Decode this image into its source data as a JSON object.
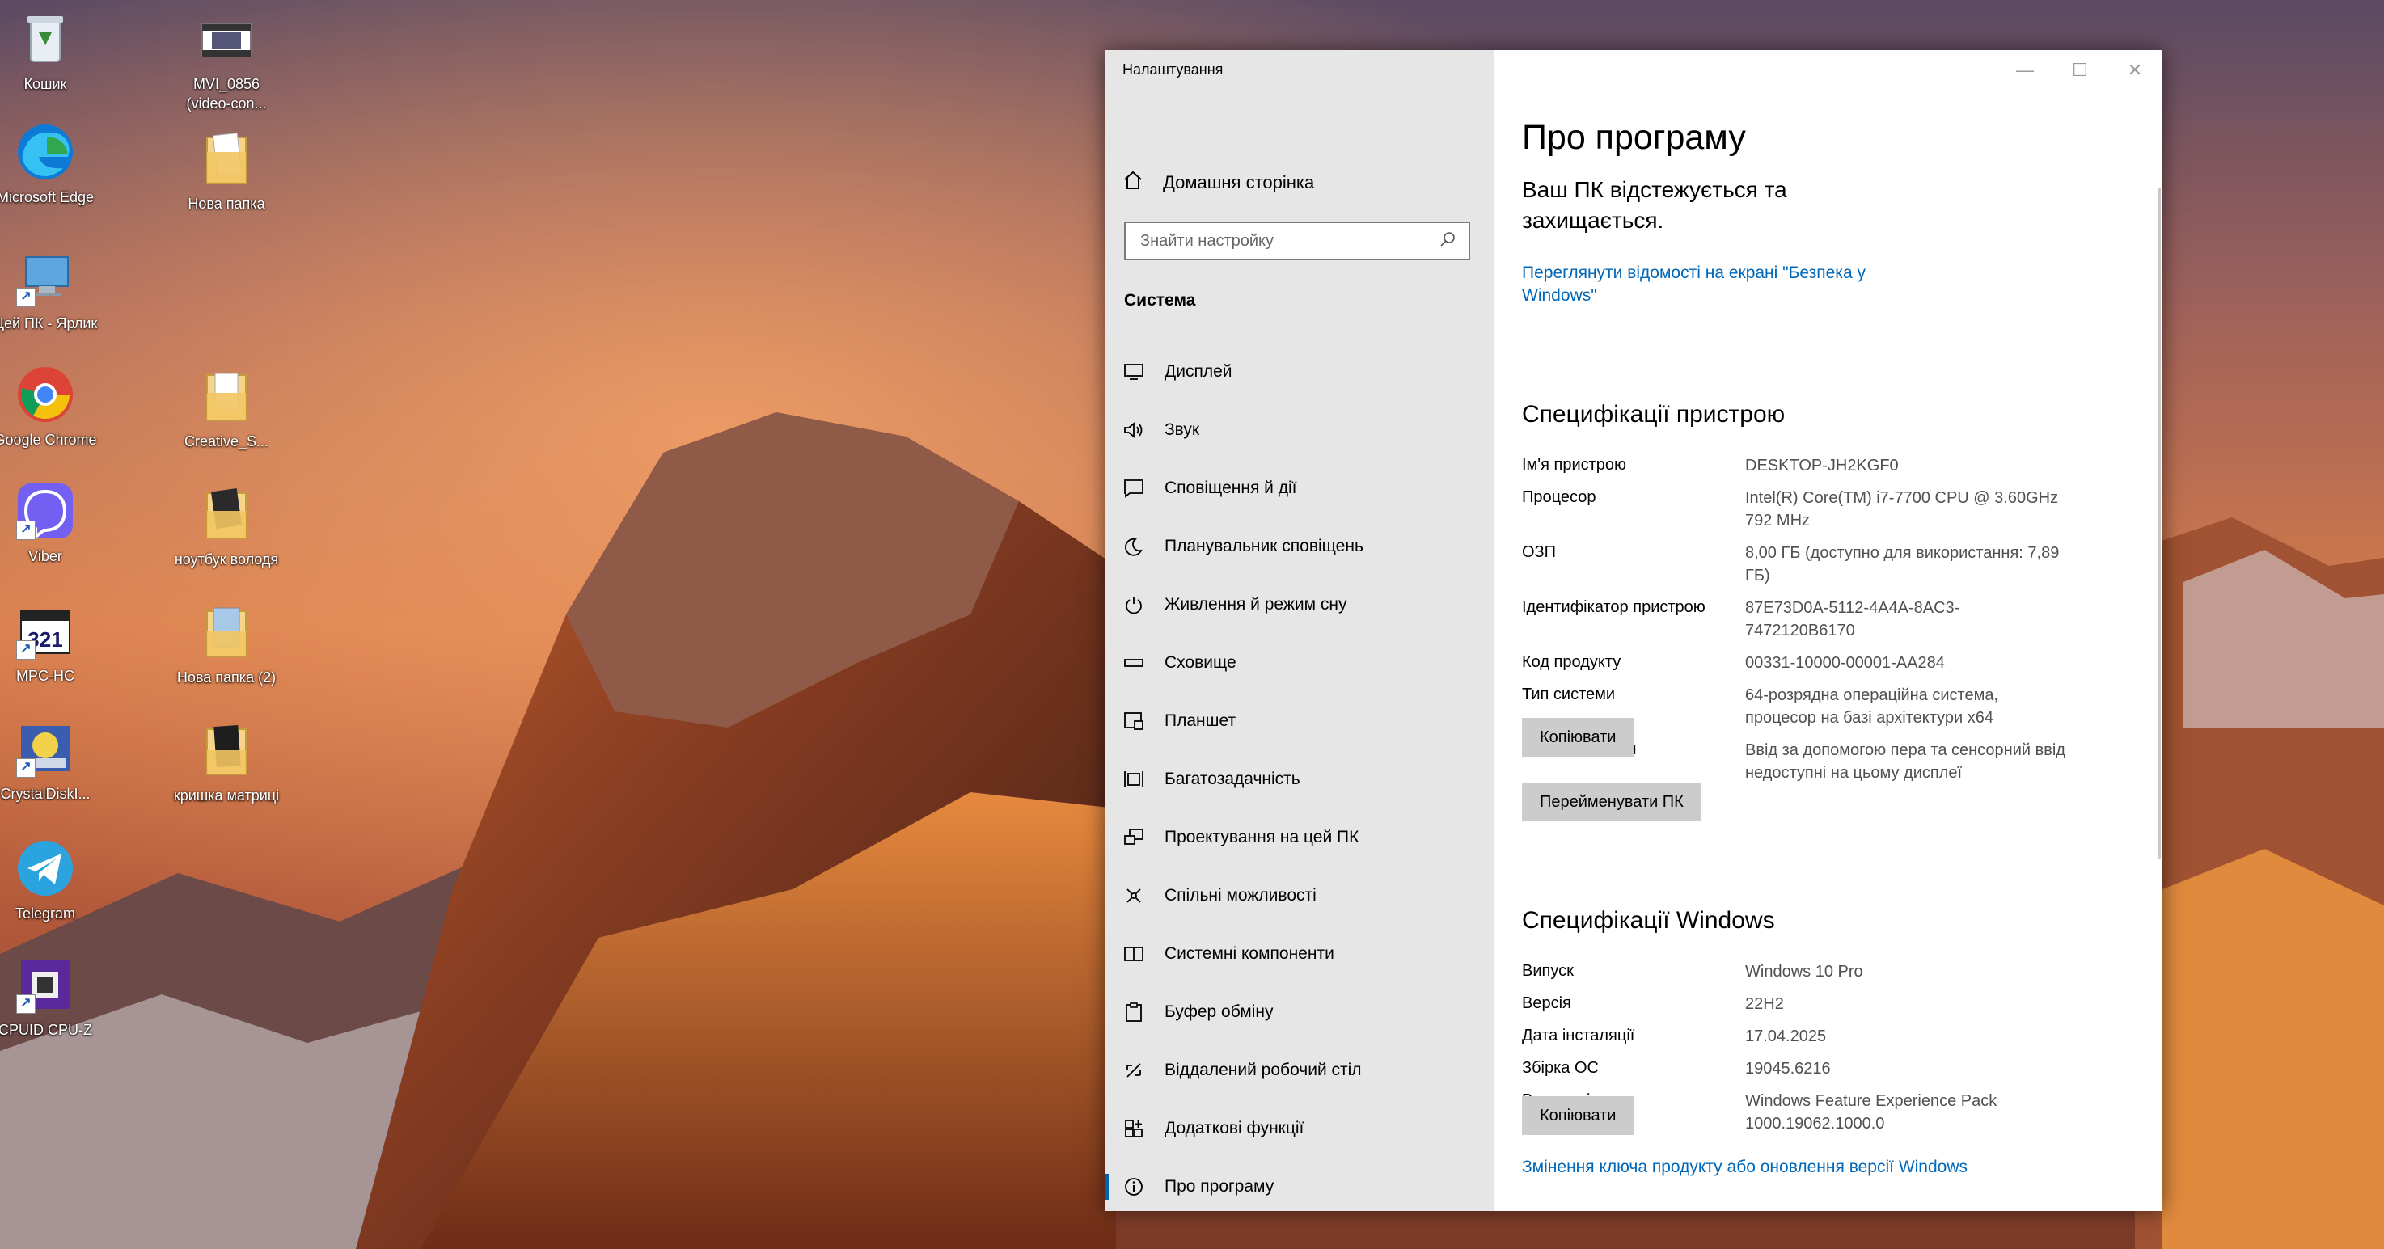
{
  "desktop": {
    "icons": [
      {
        "label": "Кошик",
        "icon": "recycle-bin-icon"
      },
      {
        "label": "MVI_0856 (video-con...",
        "icon": "video-file-icon"
      },
      {
        "label": "Microsoft Edge",
        "icon": "edge-icon"
      },
      {
        "label": "Нова папка",
        "icon": "folder-icon"
      },
      {
        "label": "Цей ПК - Ярлик",
        "icon": "this-pc-icon"
      },
      {
        "label": "Google Chrome",
        "icon": "chrome-icon"
      },
      {
        "label": "Creative_S...",
        "icon": "folder-icon"
      },
      {
        "label": "Viber",
        "icon": "viber-icon"
      },
      {
        "label": "ноутбук володя",
        "icon": "folder-icon"
      },
      {
        "label": "MPC-HC",
        "icon": "mpc-hc-icon"
      },
      {
        "label": "Нова папка (2)",
        "icon": "folder-icon"
      },
      {
        "label": "CrystalDiskI...",
        "icon": "crystaldisk-icon"
      },
      {
        "label": "кришка матриці",
        "icon": "folder-icon"
      },
      {
        "label": "Telegram",
        "icon": "telegram-icon"
      },
      {
        "label": "CPUID CPU-Z",
        "icon": "cpuz-icon"
      }
    ]
  },
  "window": {
    "title": "Налаштування",
    "controls": {
      "minimize": "—",
      "maximize": "☐",
      "close": "✕"
    }
  },
  "sidebar": {
    "home_label": "Домашня сторінка",
    "search_placeholder": "Знайти настройку",
    "section_title": "Система",
    "items": [
      {
        "label": "Дисплей",
        "icon": "display-icon"
      },
      {
        "label": "Звук",
        "icon": "sound-icon"
      },
      {
        "label": "Сповіщення й дії",
        "icon": "notifications-icon"
      },
      {
        "label": "Планувальник сповіщень",
        "icon": "focus-assist-icon"
      },
      {
        "label": "Живлення й режим сну",
        "icon": "power-icon"
      },
      {
        "label": "Сховище",
        "icon": "storage-icon"
      },
      {
        "label": "Планшет",
        "icon": "tablet-icon"
      },
      {
        "label": "Багатозадачність",
        "icon": "multitasking-icon"
      },
      {
        "label": "Проектування на цей ПК",
        "icon": "projecting-icon"
      },
      {
        "label": "Спільні можливості",
        "icon": "shared-experiences-icon"
      },
      {
        "label": "Системні компоненти",
        "icon": "system-components-icon"
      },
      {
        "label": "Буфер обміну",
        "icon": "clipboard-icon"
      },
      {
        "label": "Віддалений робочий стіл",
        "icon": "remote-desktop-icon"
      },
      {
        "label": "Додаткові функції",
        "icon": "optional-features-icon"
      },
      {
        "label": "Про програму",
        "icon": "info-icon",
        "active": true
      }
    ]
  },
  "main": {
    "title": "Про програму",
    "protect_text": "Ваш ПК відстежується та захищається.",
    "security_link": "Переглянути відомості на екрані \"Безпека у Windows\"",
    "device_specs": {
      "heading": "Специфікації пристрою",
      "rows": [
        {
          "label": "Ім'я пристрою",
          "value": "DESKTOP-JH2KGF0"
        },
        {
          "label": "Процесор",
          "value": "Intel(R) Core(TM) i7-7700 CPU @ 3.60GHz 792 MHz"
        },
        {
          "label": "ОЗП",
          "value": "8,00 ГБ (доступно для використання: 7,89 ГБ)"
        },
        {
          "label": "Ідентифікатор пристрою",
          "value": "87E73D0A-5112-4A4A-8AC3-7472120B6170"
        },
        {
          "label": "Код продукту",
          "value": "00331-10000-00001-AA284"
        },
        {
          "label": "Тип системи",
          "value": "64-розрядна операційна система, процесор на базі архітектури x64"
        },
        {
          "label": "Перо та дотики",
          "value": "Ввід за допомогою пера та сенсорний ввід недоступні на цьому дисплеї"
        }
      ],
      "copy_button": "Копіювати",
      "rename_button": "Перейменувати ПК"
    },
    "windows_specs": {
      "heading": "Специфікації Windows",
      "rows": [
        {
          "label": "Випуск",
          "value": "Windows 10 Pro"
        },
        {
          "label": "Версія",
          "value": "22H2"
        },
        {
          "label": "Дата інсталяції",
          "value": "17.04.2025"
        },
        {
          "label": "Збірка ОС",
          "value": "19045.6216"
        },
        {
          "label": "Взаємодія",
          "value": "Windows Feature Experience Pack 1000.19062.1000.0"
        }
      ],
      "copy_button": "Копіювати"
    },
    "product_key_link": "Змінення ключа продукту або оновлення версії Windows"
  }
}
